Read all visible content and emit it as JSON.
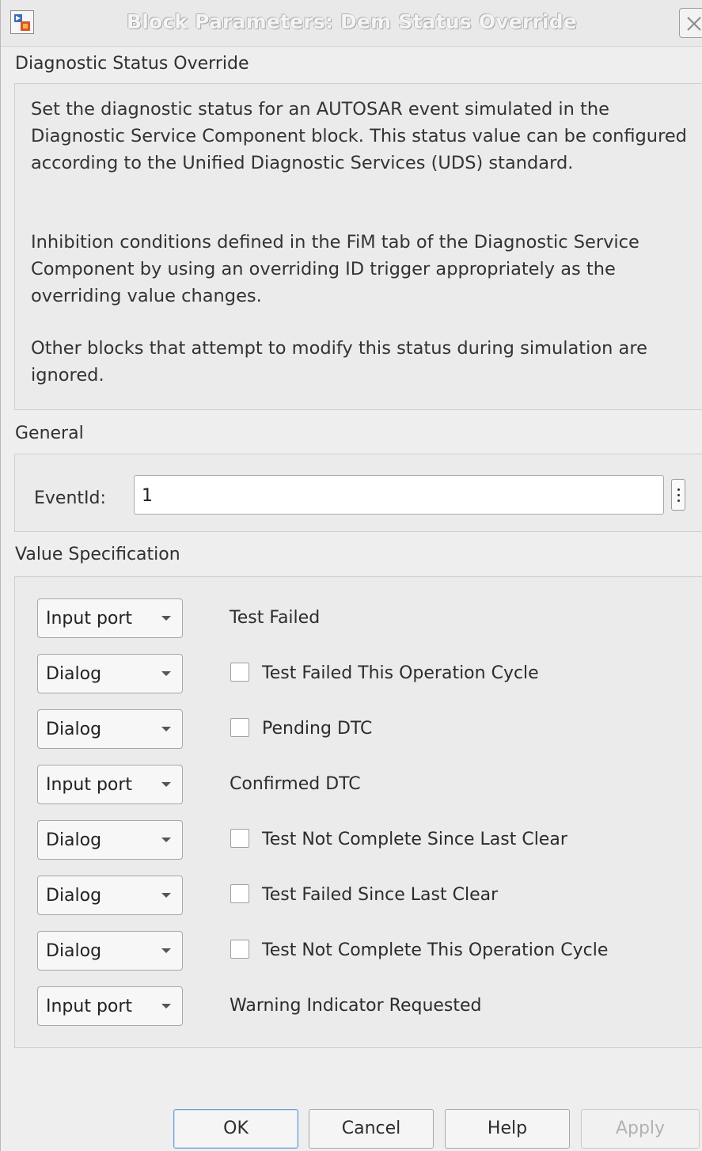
{
  "window": {
    "title": "Block Parameters: Dem Status Override"
  },
  "description_section": {
    "label": "Diagnostic Status Override",
    "paragraphs": [
      "Set the diagnostic status for an AUTOSAR event simulated in the Diagnostic Service Component block. This status value can be configured according to the Unified Diagnostic Services (UDS) standard.",
      "Inhibition conditions defined in the FiM tab of the Diagnostic Service Component by using an overriding ID trigger appropriately as the overriding value changes.",
      "Other blocks that attempt to modify this status during simulation are ignored."
    ]
  },
  "general": {
    "label": "General",
    "event_id_label": "EventId:",
    "event_id_value": "1"
  },
  "value_spec": {
    "label": "Value Specification",
    "rows": [
      {
        "source": "Input port",
        "label": "Test Failed",
        "has_checkbox": false,
        "checked": false
      },
      {
        "source": "Dialog",
        "label": "Test Failed This Operation Cycle",
        "has_checkbox": true,
        "checked": false
      },
      {
        "source": "Dialog",
        "label": "Pending DTC",
        "has_checkbox": true,
        "checked": false
      },
      {
        "source": "Input port",
        "label": "Confirmed DTC",
        "has_checkbox": false,
        "checked": false
      },
      {
        "source": "Dialog",
        "label": "Test Not Complete Since Last Clear",
        "has_checkbox": true,
        "checked": false
      },
      {
        "source": "Dialog",
        "label": "Test Failed Since Last Clear",
        "has_checkbox": true,
        "checked": false
      },
      {
        "source": "Dialog",
        "label": "Test Not Complete This Operation Cycle",
        "has_checkbox": true,
        "checked": false
      },
      {
        "source": "Input port",
        "label": "Warning Indicator Requested",
        "has_checkbox": false,
        "checked": false
      }
    ]
  },
  "buttons": {
    "ok": "OK",
    "cancel": "Cancel",
    "help": "Help",
    "apply": "Apply"
  }
}
